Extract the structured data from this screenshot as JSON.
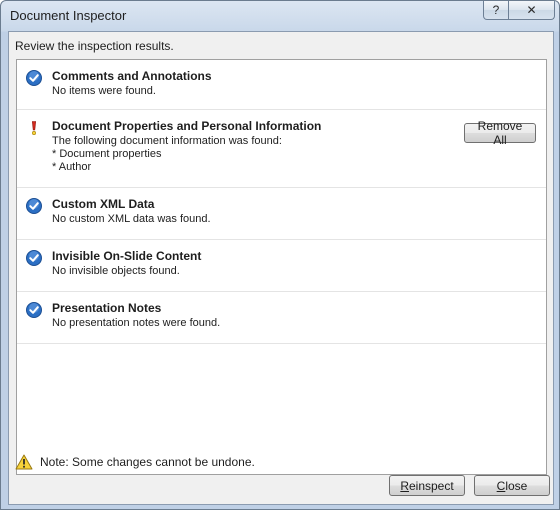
{
  "window": {
    "title": "Document Inspector",
    "help_glyph": "?",
    "close_glyph": "✕"
  },
  "instruction": "Review the inspection results.",
  "results": [
    {
      "status": "checked",
      "title": "Comments and Annotations",
      "lines": [
        "No items were found."
      ]
    },
    {
      "status": "warning",
      "title": "Document Properties and Personal Information",
      "lines": [
        "The following document information was found:",
        "* Document properties",
        "* Author"
      ],
      "action_label": "Remove All"
    },
    {
      "status": "checked",
      "title": "Custom XML Data",
      "lines": [
        "No custom XML data was found."
      ]
    },
    {
      "status": "checked",
      "title": "Invisible On-Slide Content",
      "lines": [
        "No invisible objects found."
      ]
    },
    {
      "status": "checked",
      "title": "Presentation Notes",
      "lines": [
        "No presentation notes were found."
      ]
    }
  ],
  "note": "Note: Some changes cannot be undone.",
  "buttons": {
    "reinspect": {
      "accel": "R",
      "rest": "einspect"
    },
    "close": {
      "accel": "C",
      "rest": "lose"
    }
  },
  "colors": {
    "check_blue": "#2b6fc4",
    "warning_red": "#d22a1e",
    "warning_yellow": "#f7d23a"
  }
}
